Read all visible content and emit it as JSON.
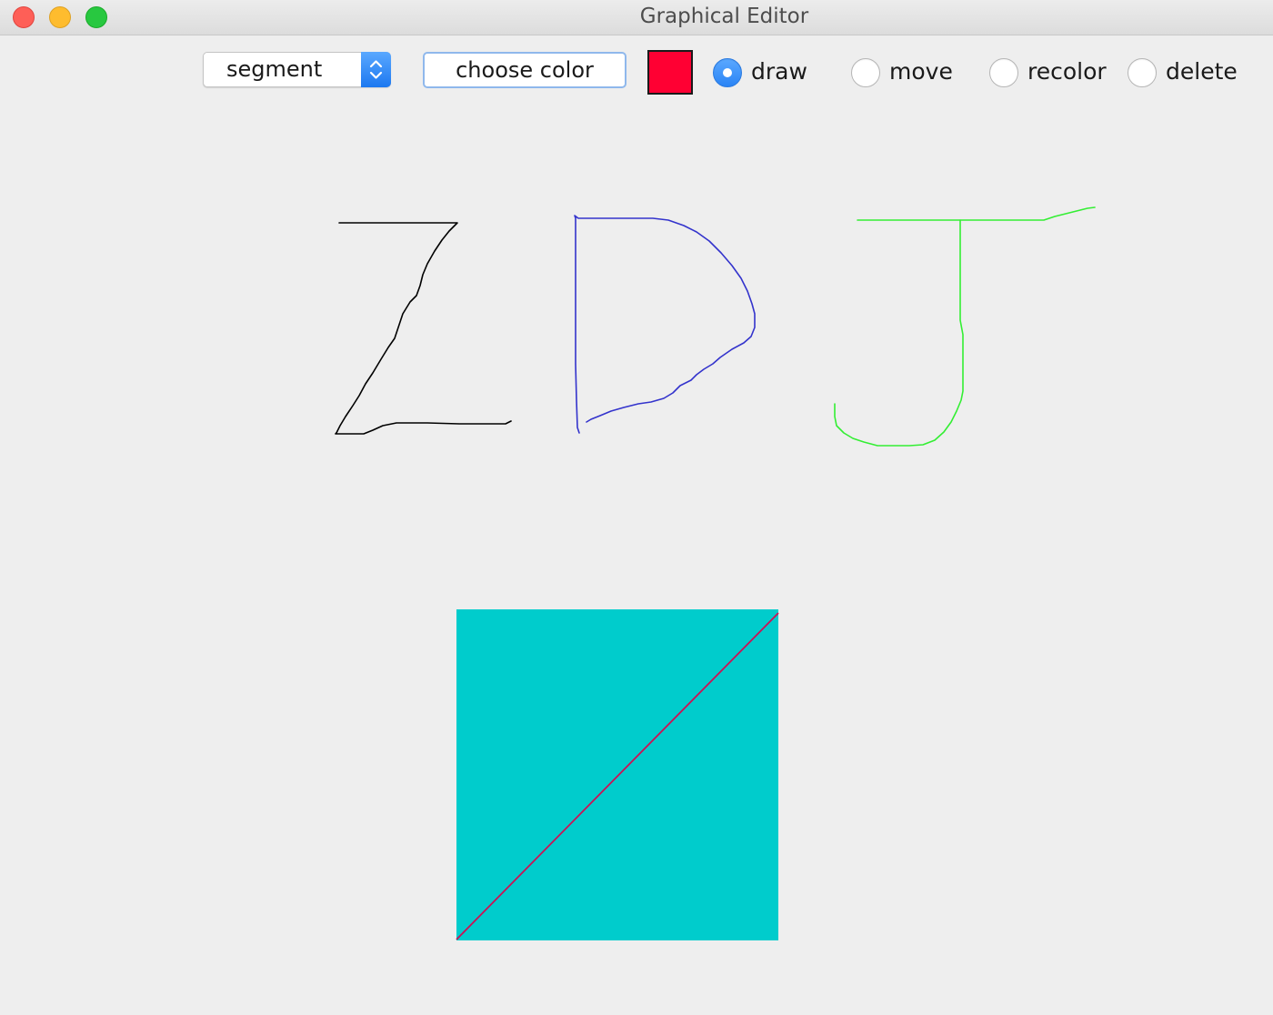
{
  "window": {
    "title": "Graphical Editor"
  },
  "toolbar": {
    "shape_select": {
      "selected": "segment"
    },
    "choose_color_label": "choose color",
    "current_color": "#ff0033",
    "modes": [
      {
        "label": "draw",
        "checked": true
      },
      {
        "label": "move",
        "checked": false
      },
      {
        "label": "recolor",
        "checked": false
      },
      {
        "label": "delete",
        "checked": false
      }
    ]
  },
  "canvas": {
    "shapes": [
      {
        "type": "freehand",
        "color": "#000000",
        "depicts": "letter Z"
      },
      {
        "type": "freehand",
        "color": "#3333cc",
        "depicts": "letter D"
      },
      {
        "type": "freehand",
        "color": "#33ee33",
        "depicts": "letter J"
      },
      {
        "type": "rectangle",
        "color": "#00cccc"
      },
      {
        "type": "segment",
        "color": "#cc1155"
      }
    ]
  },
  "colors": {
    "accent": "#2a84f5",
    "background": "#eeeeee"
  }
}
